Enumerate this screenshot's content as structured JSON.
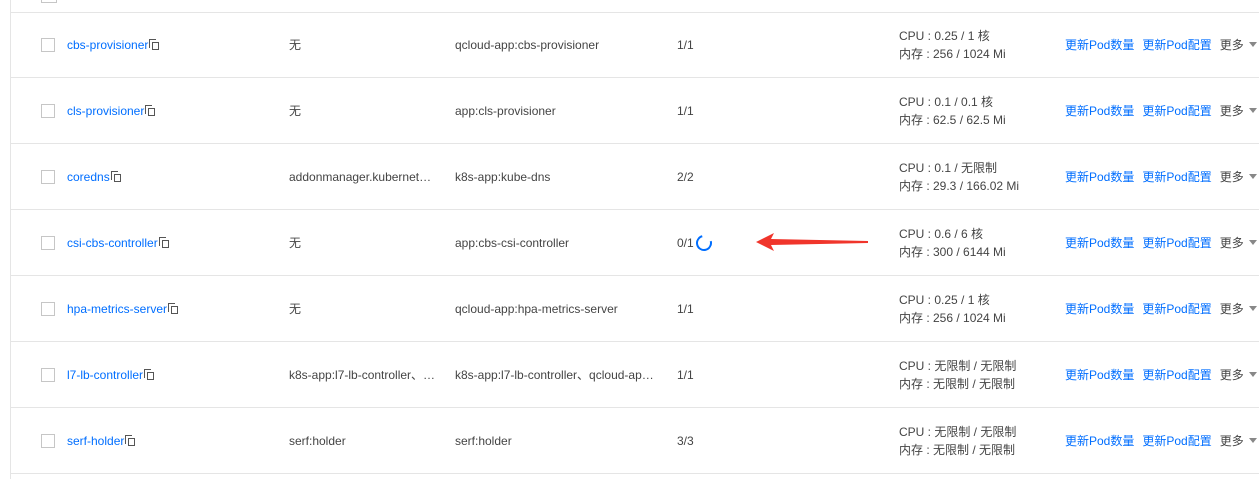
{
  "rows": [
    {
      "name": "cbs-provisioner",
      "labels": "无",
      "selector": "qcloud-app:cbs-provisioner",
      "pods": "1/1",
      "loading": false,
      "cpu": "CPU : 0.25 / 1 核",
      "mem": "内存 : 256 / 1024 Mi"
    },
    {
      "name": "cls-provisioner",
      "labels": "无",
      "selector": "app:cls-provisioner",
      "pods": "1/1",
      "loading": false,
      "cpu": "CPU : 0.1 / 0.1 核",
      "mem": "内存 : 62.5 / 62.5 Mi"
    },
    {
      "name": "coredns",
      "labels": "addonmanager.kubernet…",
      "selector": "k8s-app:kube-dns",
      "pods": "2/2",
      "loading": false,
      "cpu": "CPU : 0.1 / 无限制",
      "mem": "内存 : 29.3 / 166.02 Mi"
    },
    {
      "name": "csi-cbs-controller",
      "labels": "无",
      "selector": "app:cbs-csi-controller",
      "pods": "0/1",
      "loading": true,
      "cpu": "CPU : 0.6 / 6 核",
      "mem": "内存 : 300 / 6144 Mi"
    },
    {
      "name": "hpa-metrics-server",
      "labels": "无",
      "selector": "qcloud-app:hpa-metrics-server",
      "pods": "1/1",
      "loading": false,
      "cpu": "CPU : 0.25 / 1 核",
      "mem": "内存 : 256 / 1024 Mi"
    },
    {
      "name": "l7-lb-controller",
      "labels": "k8s-app:l7-lb-controller、…",
      "selector": "k8s-app:l7-lb-controller、qcloud-ap…",
      "pods": "1/1",
      "loading": false,
      "cpu": "CPU : 无限制 / 无限制",
      "mem": "内存 : 无限制 / 无限制"
    },
    {
      "name": "serf-holder",
      "labels": "serf:holder",
      "selector": "serf:holder",
      "pods": "3/3",
      "loading": false,
      "cpu": "CPU : 无限制 / 无限制",
      "mem": "内存 : 无限制 / 无限制"
    }
  ],
  "actions": {
    "update_count": "更新Pod数量",
    "update_config": "更新Pod配置",
    "more": "更多"
  },
  "colors": {
    "link": "#006eff",
    "annotation_arrow": "#f0352b"
  }
}
